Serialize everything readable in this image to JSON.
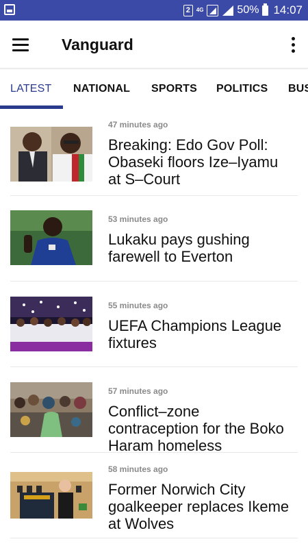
{
  "status_bar": {
    "sim_slot": "2",
    "network_type": "4G",
    "battery": "50%",
    "time": "14:07"
  },
  "app_bar": {
    "title": "Vanguard"
  },
  "tabs": [
    "LATEST",
    "NATIONAL",
    "SPORTS",
    "POLITICS",
    "BUS"
  ],
  "active_tab": "LATEST",
  "accent_color": "#2a3a8c",
  "status_bar_color": "#3b4aa6",
  "articles": [
    {
      "time": "47 minutes ago",
      "headline": "Breaking: Edo Gov Poll: Obaseki floors Ize–Iyamu at S–Court"
    },
    {
      "time": "53 minutes ago",
      "headline": "Lukaku pays gushing farewell to Everton"
    },
    {
      "time": "55 minutes ago",
      "headline": "UEFA Champions League fixtures"
    },
    {
      "time": "57 minutes ago",
      "headline": "Conflict–zone contraception for the Boko Haram homeless"
    },
    {
      "time": "58 minutes ago",
      "headline": "Former Norwich City goalkeeper replaces Ikeme at Wolves"
    }
  ]
}
